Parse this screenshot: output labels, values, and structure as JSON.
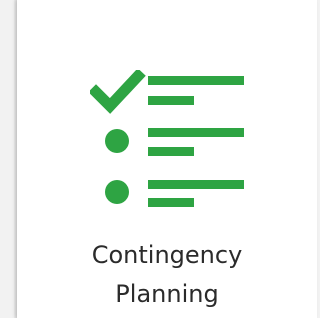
{
  "card": {
    "title_line1": "Contingency",
    "title_line2": "Planning",
    "icon": "checklist-icon",
    "accent_color": "#2ea443"
  }
}
